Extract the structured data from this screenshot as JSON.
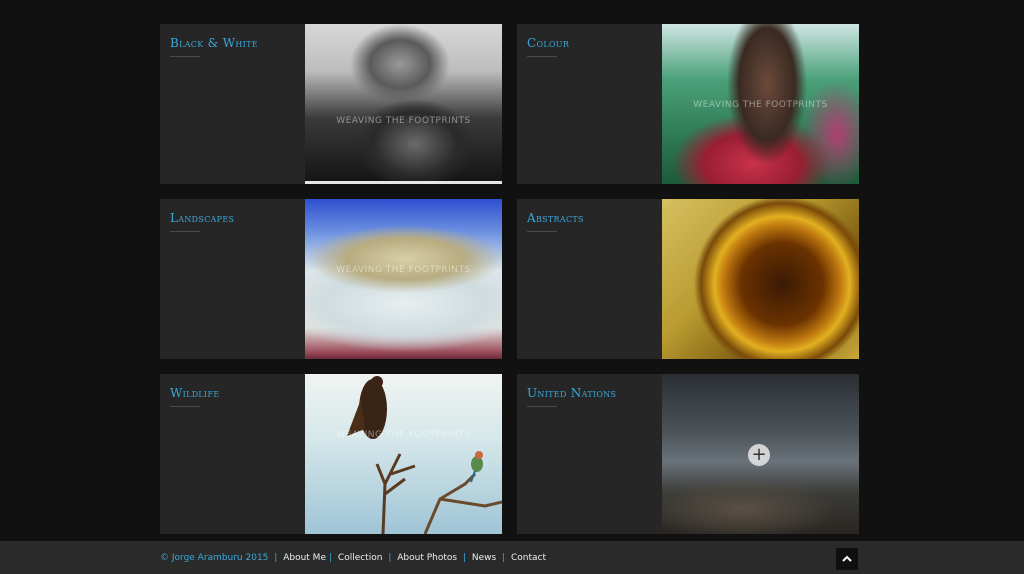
{
  "watermark": "WEAVING THE FOOTPRINTS",
  "cards": [
    {
      "title": "Black & White",
      "image": "portrait-elder-smoking",
      "image_alt": "black-and-white"
    },
    {
      "title": "Colour",
      "image": "maasai-portrait",
      "image_alt": "colour"
    },
    {
      "title": "Landscapes",
      "image": "snow-capped-mountain",
      "image_alt": "landscape"
    },
    {
      "title": "Abstracts",
      "image": "golden-abstract",
      "image_alt": "abstract"
    },
    {
      "title": "Wildlife",
      "image": "birds-on-branch",
      "image_alt": "wildlife"
    },
    {
      "title": "United Nations",
      "image": "un-vehicle-landscape",
      "image_alt": "united-nations",
      "overlay_icon": "plus-icon"
    }
  ],
  "footer": {
    "copyright": "© Jorge Aramburu 2015",
    "links": [
      "About Me",
      "Collection",
      "About Photos",
      "News",
      "Contact"
    ],
    "separator": "|"
  },
  "scroll_top": {
    "icon": "chevron-up-icon"
  },
  "colors": {
    "accent": "#39a9dc",
    "background": "#111111",
    "card": "#262626",
    "footer": "#2a2a2a"
  }
}
